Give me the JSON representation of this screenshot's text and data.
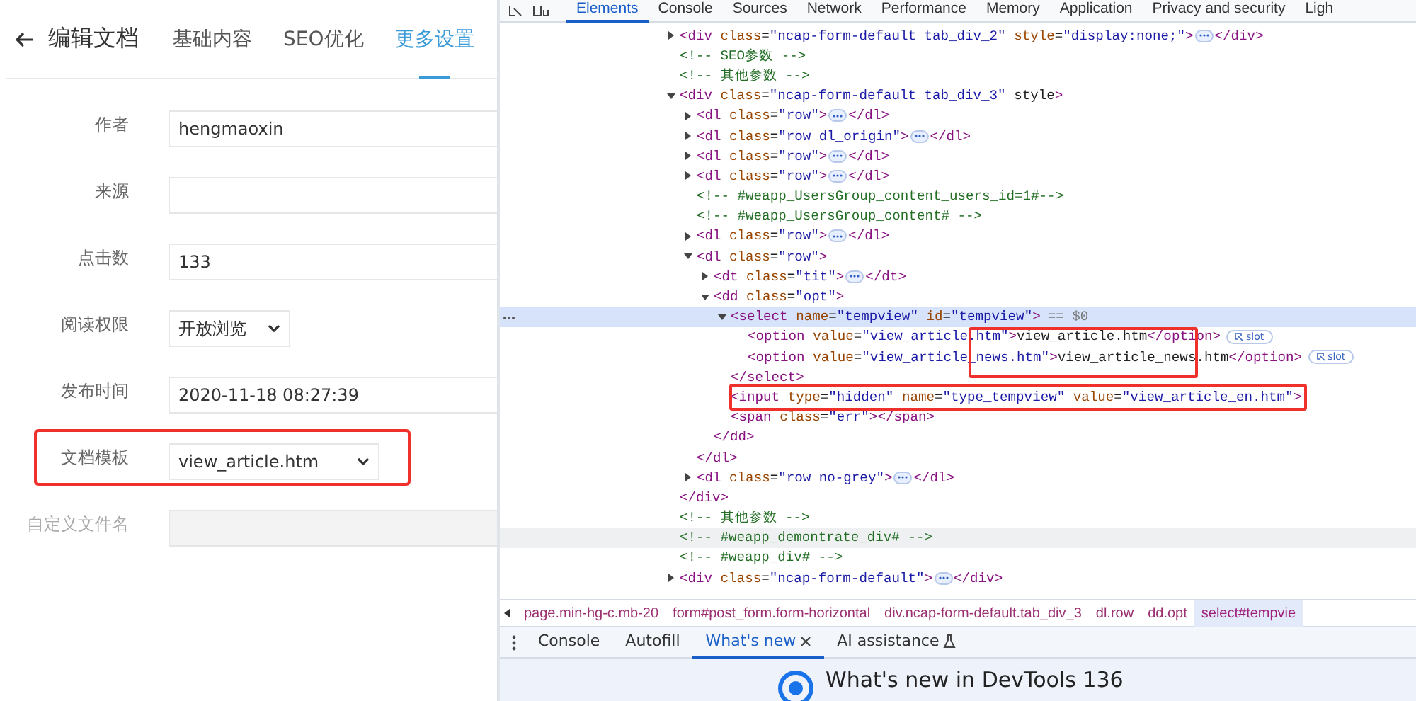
{
  "editor": {
    "title": "编辑文档",
    "tabs": [
      {
        "label": "基础内容",
        "selected": false
      },
      {
        "label": "SEO优化",
        "selected": false
      },
      {
        "label": "更多设置",
        "selected": true
      }
    ],
    "rows": [
      {
        "label": "作者",
        "kind": "text",
        "value": "hengmaoxin",
        "annotated": false
      },
      {
        "label": "来源",
        "kind": "text",
        "value": "",
        "annotated": false
      },
      {
        "label": "点击数",
        "kind": "text",
        "value": "133",
        "annotated": false
      },
      {
        "label": "阅读权限",
        "kind": "select",
        "value": "开放浏览",
        "annotated": false
      },
      {
        "label": "发布时间",
        "kind": "text",
        "value": "2020-11-18 08:27:39",
        "annotated": false
      },
      {
        "label": "文档模板",
        "kind": "select",
        "value": "view_article.htm",
        "annotated": true
      },
      {
        "label": "自定义文件名",
        "kind": "disabled",
        "value": "",
        "annotated": false
      }
    ]
  },
  "devtools": {
    "tabs": [
      {
        "label": "Elements",
        "selected": true
      },
      {
        "label": "Console",
        "selected": false
      },
      {
        "label": "Sources",
        "selected": false
      },
      {
        "label": "Network",
        "selected": false
      },
      {
        "label": "Performance",
        "selected": false
      },
      {
        "label": "Memory",
        "selected": false
      },
      {
        "label": "Application",
        "selected": false
      },
      {
        "label": "Privacy and security",
        "selected": false
      },
      {
        "label": "Ligh",
        "selected": false
      }
    ],
    "dom": [
      {
        "open": "<div class=\"ncap-form-default tab_div_2\" style=\"display:none;\">",
        "close": "</div>",
        "expanded": false,
        "selected": false,
        "hovered": false
      },
      {
        "open": "<!-- SEO参数 -->",
        "selected": false,
        "hovered": false
      },
      {
        "open": "<!-- 其他参数 -->",
        "selected": false,
        "hovered": false
      },
      {
        "open": "<div class=\"ncap-form-default tab_div_3\" style>",
        "close": "</div>",
        "expanded": true,
        "selected": false,
        "hovered": false,
        "children": [
          {
            "open": "<dl class=\"row\">",
            "close": "</dl>",
            "expanded": false,
            "selected": false,
            "hovered": false
          },
          {
            "open": "<dl class=\"row dl_origin\">",
            "close": "</dl>",
            "expanded": false,
            "selected": false,
            "hovered": false
          },
          {
            "open": "<dl class=\"row\">",
            "close": "</dl>",
            "expanded": false,
            "selected": false,
            "hovered": false
          },
          {
            "open": "<dl class=\"row\">",
            "close": "</dl>",
            "expanded": false,
            "selected": false,
            "hovered": false
          },
          {
            "open": "<!-- #weapp_UsersGroup_content_users_id=1#-->",
            "selected": false,
            "hovered": false
          },
          {
            "open": "<!-- #weapp_UsersGroup_content# -->",
            "selected": false,
            "hovered": false
          },
          {
            "open": "<dl class=\"row\">",
            "close": "</dl>",
            "expanded": false,
            "selected": false,
            "hovered": false
          },
          {
            "open": "<dl class=\"row\">",
            "close": "</dl>",
            "expanded": true,
            "selected": false,
            "hovered": false,
            "children": [
              {
                "open": "<dt class=\"tit\">",
                "close": "</dt>",
                "expanded": false,
                "selected": false,
                "hovered": false
              },
              {
                "open": "<dd class=\"opt\">",
                "close": "</dd>",
                "expanded": true,
                "selected": false,
                "hovered": false,
                "children": [
                  {
                    "open": "<select name=\"tempview\" id=\"tempview\">",
                    "suffix": "== $0",
                    "close": "</select>",
                    "expanded": true,
                    "selected": true,
                    "annotated": true,
                    "children": [
                      {
                        "open": "<option value=\"view_article.htm\">view_article.htm</option>",
                        "badge": "slot",
                        "selected": false,
                        "hovered": false
                      },
                      {
                        "open": "<option value=\"view_article_news.htm\">view_article_news.htm</option>",
                        "badge": "slot",
                        "selected": false,
                        "hovered": false
                      }
                    ]
                  },
                  {
                    "open": "<input type=\"hidden\" name=\"type_tempview\" value=\"view_article_en.htm\">",
                    "selected": false,
                    "hovered": false,
                    "annotated": true
                  },
                  {
                    "open": "<span class=\"err\"></span>",
                    "selected": false,
                    "hovered": false
                  }
                ]
              }
            ]
          },
          {
            "open": "<dl class=\"row no-grey\">",
            "close": "</dl>",
            "expanded": false,
            "selected": false,
            "hovered": false
          }
        ]
      },
      {
        "open": "<!-- 其他参数 -->",
        "selected": false,
        "hovered": false
      },
      {
        "open": "<!-- #weapp_demontrate_div# -->",
        "selected": false,
        "hovered": true
      },
      {
        "open": "<!-- #weapp_div# -->",
        "selected": false,
        "hovered": false
      },
      {
        "open": "<div class=\"ncap-form-default\">",
        "close": "</div>",
        "expanded": false,
        "selected": false,
        "hovered": false
      }
    ],
    "breadcrumbs": [
      {
        "label": "page.min-hg-c.mb-20",
        "selected": false
      },
      {
        "label": "form#post_form.form-horizontal",
        "selected": false
      },
      {
        "label": "div.ncap-form-default.tab_div_3",
        "selected": false
      },
      {
        "label": "dl.row",
        "selected": false
      },
      {
        "label": "dd.opt",
        "selected": false
      },
      {
        "label": "select#tempvie",
        "selected": true
      }
    ],
    "drawer_tabs": [
      {
        "label": "Console",
        "selected": false,
        "kind": "plain"
      },
      {
        "label": "Autofill",
        "selected": false,
        "kind": "plain"
      },
      {
        "label": "What's new",
        "selected": true,
        "kind": "closable"
      },
      {
        "label": "AI assistance",
        "selected": false,
        "kind": "experimental"
      }
    ],
    "drawer_heading": "What's new in DevTools 136"
  }
}
